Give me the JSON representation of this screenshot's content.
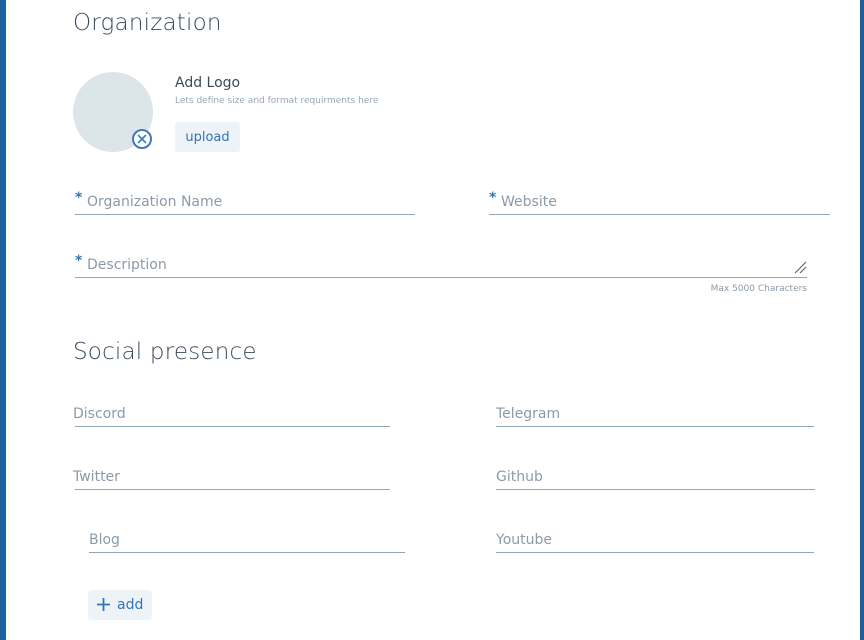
{
  "organization": {
    "section_title": "Organization",
    "logo": {
      "heading": "Add Logo",
      "hint": "Lets define size and format requirments here",
      "upload_label": "upload",
      "remove_icon": "close-circle-icon"
    },
    "fields": {
      "org_name": {
        "placeholder": "Organization Name",
        "required": true,
        "required_mark": "*"
      },
      "website": {
        "placeholder": "Website",
        "required": true,
        "required_mark": "*"
      },
      "description": {
        "placeholder": "Description",
        "required": true,
        "required_mark": "*",
        "limit_text": "Max 5000 Characters"
      }
    }
  },
  "social": {
    "section_title": "Social presence",
    "fields": {
      "discord": {
        "placeholder": "Discord"
      },
      "telegram": {
        "placeholder": "Telegram"
      },
      "twitter": {
        "placeholder": "Twitter"
      },
      "github": {
        "placeholder": "Github"
      },
      "blog": {
        "placeholder": "Blog"
      },
      "youtube": {
        "placeholder": "Youtube"
      }
    },
    "add_label": "add",
    "add_icon": "plus-icon"
  },
  "colors": {
    "accent": "#3474b5",
    "frame": "#1f5f9c",
    "text": "#3b4a5a",
    "placeholder": "#8c9aa7",
    "avatar_bg": "#dce5ea",
    "button_bg": "#eef3f7"
  }
}
